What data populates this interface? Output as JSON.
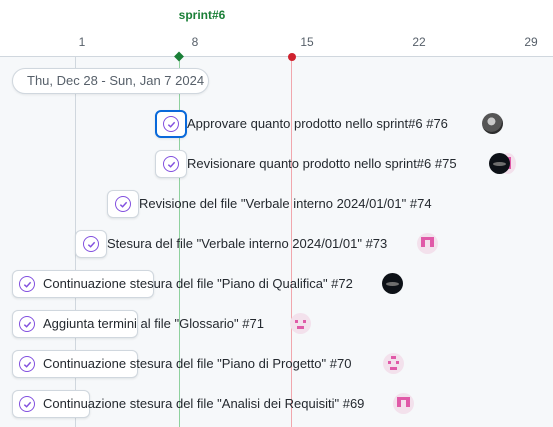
{
  "timeline": {
    "iteration_label": "sprint#6",
    "ticks": [
      "1",
      "8",
      "15",
      "22",
      "29"
    ],
    "iteration_color": "#1a7f37",
    "today_color": "#cf222e"
  },
  "date_range": "Thu, Dec 28 - Sun, Jan 7 2024",
  "issues": [
    {
      "title": "Approvare quanto prodotto nello sprint#6 #76",
      "status": "closed",
      "assignee": "photo-avatar",
      "selected": true
    },
    {
      "title": "Revisionare quanto prodotto nello sprint#6 #75",
      "status": "closed",
      "assignee": "dark-avatar"
    },
    {
      "title": "Revisione del file \"Verbale interno 2024/01/01\" #74",
      "status": "closed",
      "assignee": ""
    },
    {
      "title": "Stesura del file \"Verbale interno 2024/01/01\" #73",
      "status": "closed",
      "assignee": "pink-identicon"
    },
    {
      "title": "Continuazione stesura del file \"Piano di Qualifica\" #72",
      "status": "closed",
      "assignee": "dark-avatar"
    },
    {
      "title": "Aggiunta termini al file \"Glossario\" #71",
      "status": "closed",
      "assignee": "pink-identicon"
    },
    {
      "title": "Continuazione stesura del file \"Piano di Progetto\" #70",
      "status": "closed",
      "assignee": "pink-identicon"
    },
    {
      "title": "Continuazione stesura del file \"Analisi dei Requisiti\" #69",
      "status": "closed",
      "assignee": "pink-identicon"
    }
  ],
  "colors": {
    "closed_status": "#8250df",
    "selection": "#0969da",
    "canvas": "#f6f8fa"
  }
}
